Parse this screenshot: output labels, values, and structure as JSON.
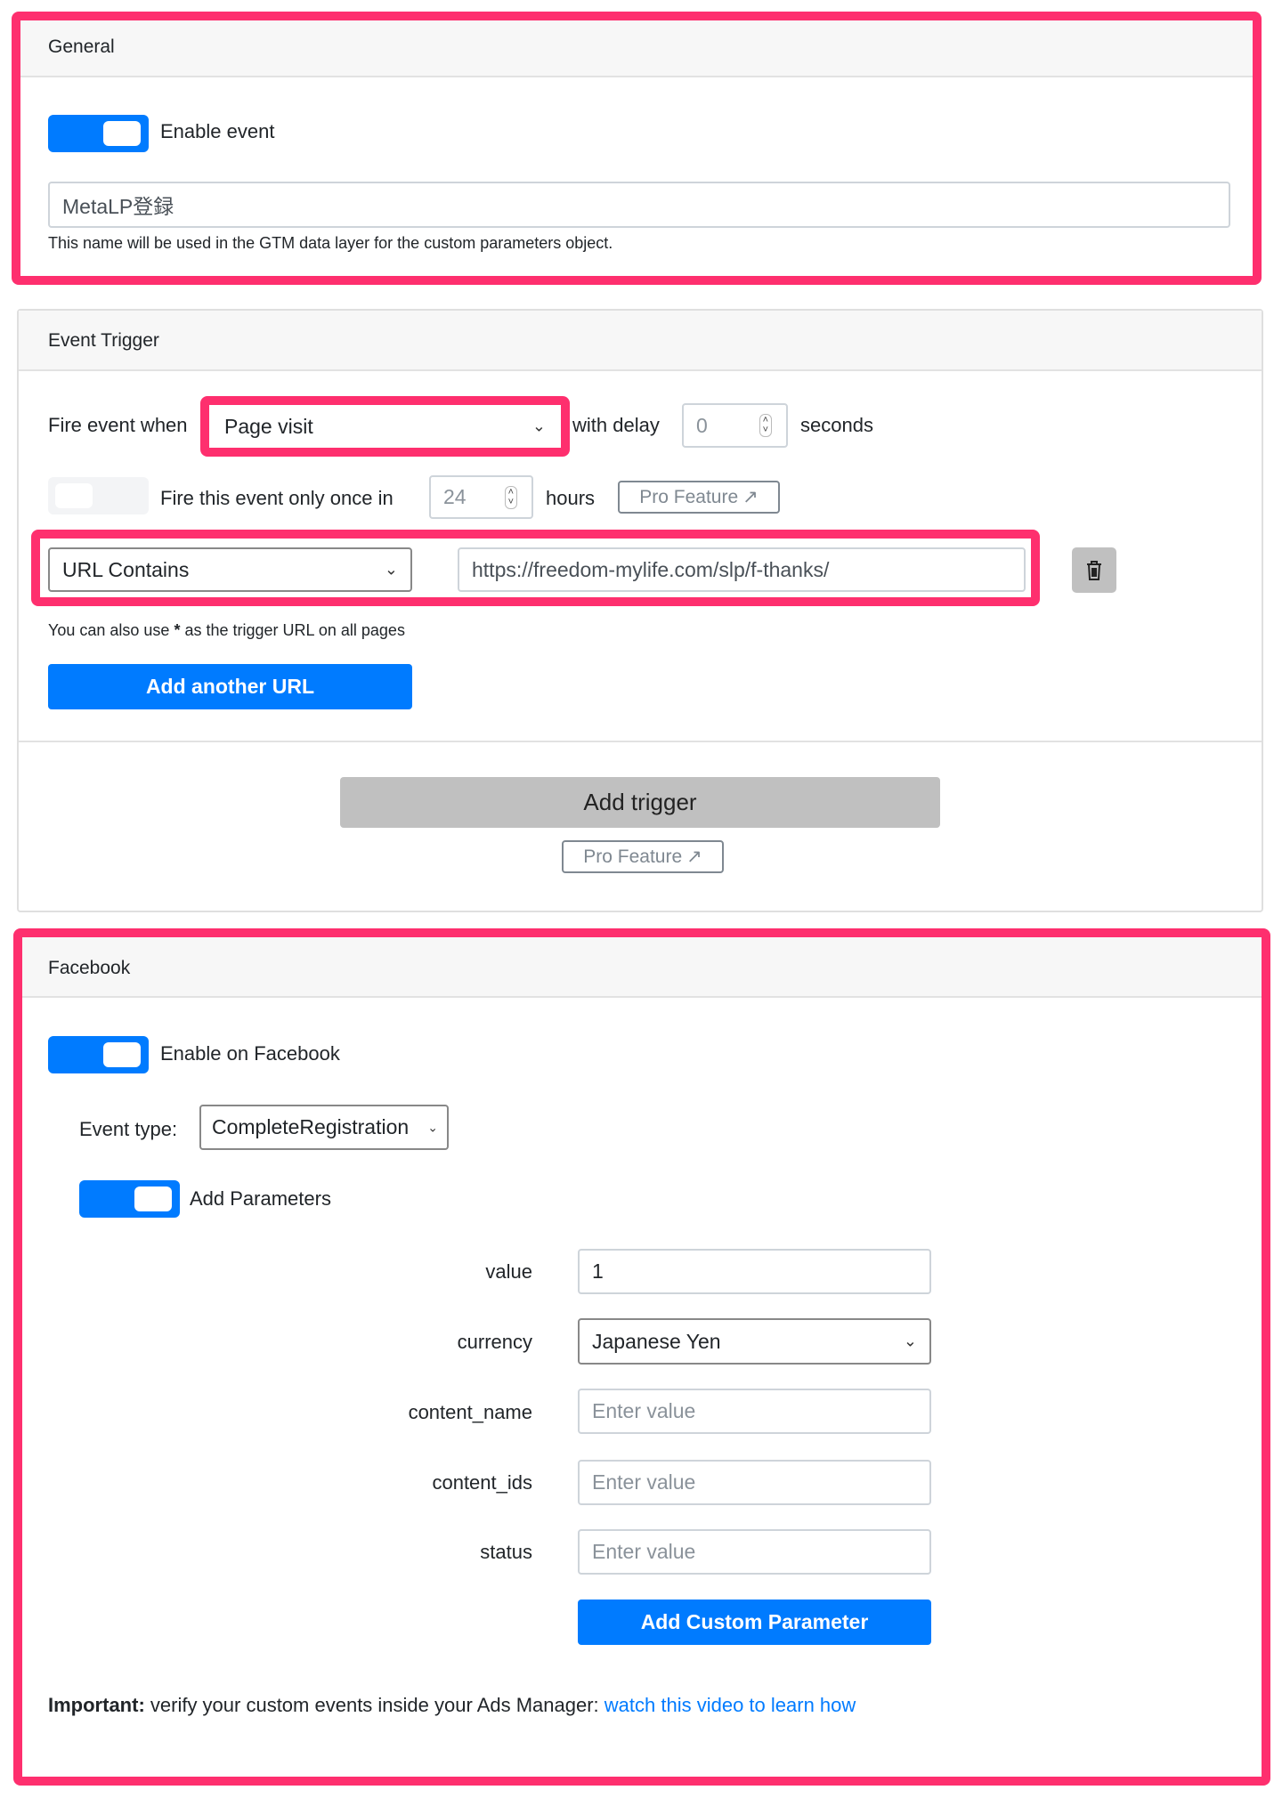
{
  "colors": {
    "accent": "#007bff",
    "highlight": "#fe2f6e",
    "disabled_button": "#c0c0c0"
  },
  "general": {
    "title": "General",
    "enable_toggle": {
      "on": true,
      "label": "Enable event"
    },
    "event_name": "MetaLP登録",
    "help": "This name will be used in the GTM data layer for the custom parameters object."
  },
  "trigger": {
    "title": "Event Trigger",
    "fire_when_label": "Fire event when",
    "fire_when_value": "Page visit",
    "with_delay_label": "with delay",
    "delay_value": "0",
    "seconds_label": "seconds",
    "once_toggle": {
      "on": false,
      "label": "Fire this event only once in"
    },
    "once_hours": "24",
    "hours_label": "hours",
    "pro_feature": "Pro Feature",
    "url_condition": "URL Contains",
    "url_value": "https://freedom-mylife.com/slp/f-thanks/",
    "help_prefix": "You can also use ",
    "help_star": "*",
    "help_suffix": " as the trigger URL on all pages",
    "add_url": "Add another URL",
    "add_trigger": "Add trigger",
    "pro_feature2": "Pro Feature"
  },
  "facebook": {
    "title": "Facebook",
    "enable_toggle": {
      "on": true,
      "label": "Enable on Facebook"
    },
    "event_type_label": "Event type:",
    "event_type_value": "CompleteRegistration",
    "params_toggle": {
      "on": true,
      "label": "Add Parameters"
    },
    "params": [
      {
        "name": "value",
        "value": "1",
        "placeholder": ""
      },
      {
        "name": "currency",
        "value": "Japanese Yen",
        "placeholder": ""
      },
      {
        "name": "content_name",
        "value": "",
        "placeholder": "Enter value"
      },
      {
        "name": "content_ids",
        "value": "",
        "placeholder": "Enter value"
      },
      {
        "name": "status",
        "value": "",
        "placeholder": "Enter value"
      }
    ],
    "add_custom": "Add Custom Parameter",
    "important_bold": "Important:",
    "important_text": " verify your custom events inside your Ads Manager: ",
    "important_link": "watch this video to learn how"
  }
}
